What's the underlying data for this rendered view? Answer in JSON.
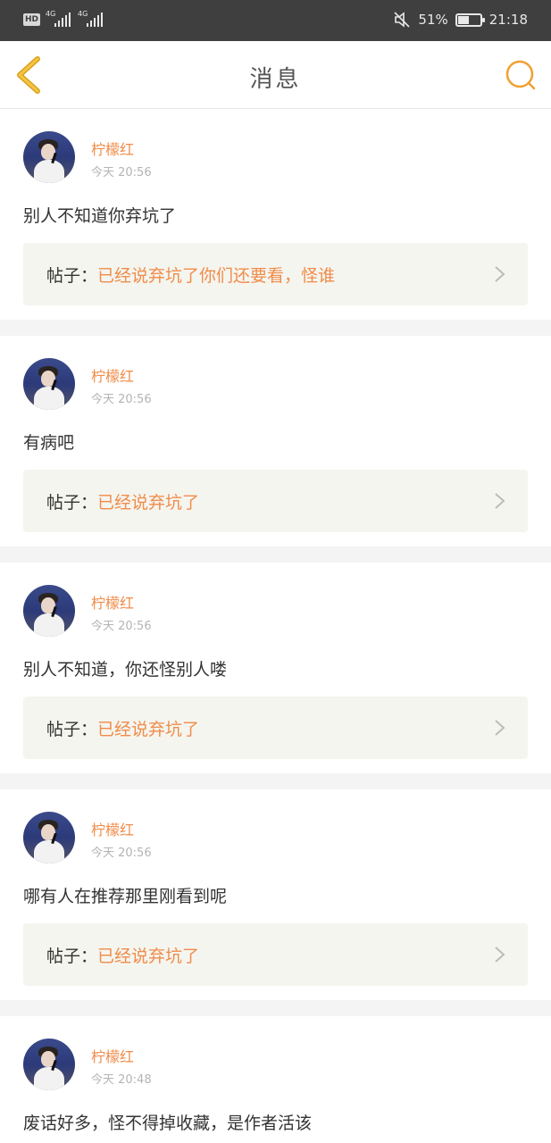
{
  "status_bar": {
    "hd": "HD",
    "network_1": "4G",
    "network_2": "4G",
    "battery_percent": "51%",
    "battery_level": 0.51,
    "time": "21:18"
  },
  "nav": {
    "title": "消息",
    "back_icon": "chevron-left-icon",
    "search_icon": "search-icon",
    "accent_color": "#f0a032"
  },
  "messages": [
    {
      "author": "柠檬红",
      "time": "今天 20:56",
      "comment": "别人不知道你弃坑了",
      "post_label": "帖子：",
      "post_title": "已经说弃坑了你们还要看，怪谁"
    },
    {
      "author": "柠檬红",
      "time": "今天 20:56",
      "comment": "有病吧",
      "post_label": "帖子：",
      "post_title": "已经说弃坑了"
    },
    {
      "author": "柠檬红",
      "time": "今天 20:56",
      "comment": "别人不知道，你还怪别人喽",
      "post_label": "帖子：",
      "post_title": "已经说弃坑了"
    },
    {
      "author": "柠檬红",
      "time": "今天 20:56",
      "comment": "哪有人在推荐那里刚看到呢",
      "post_label": "帖子：",
      "post_title": "已经说弃坑了"
    },
    {
      "author": "柠檬红",
      "time": "今天 20:48",
      "comment": "废话好多，怪不得掉收藏，是作者活该"
    }
  ],
  "colors": {
    "accent": "#f08c4a",
    "status_bar_bg": "#3f3f3f",
    "post_box_bg": "#f5f5ef"
  }
}
